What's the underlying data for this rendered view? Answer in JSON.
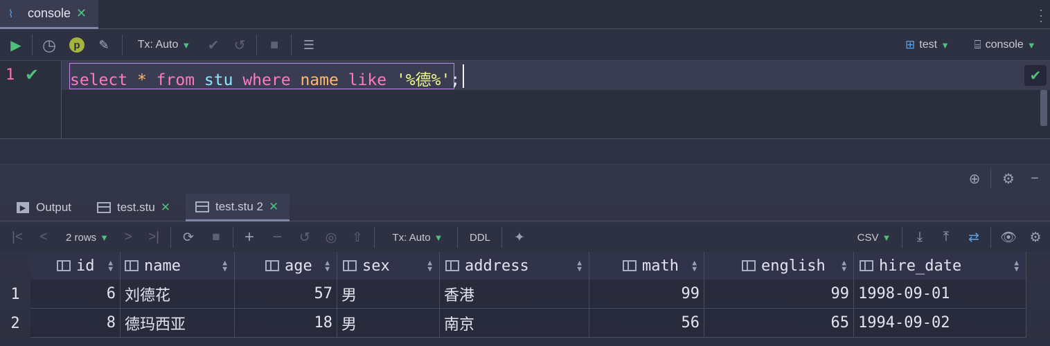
{
  "editor_tab": {
    "label": "console",
    "close": "✕"
  },
  "toolbar": {
    "run": "▶",
    "history": "◷",
    "profile": "p",
    "settings": "🔧",
    "tx_mode": "Tx: Auto",
    "commit": "✔",
    "rollback": "↺",
    "stop": "■",
    "datasource_label": "test",
    "session_label": "console"
  },
  "editor": {
    "line_number": "1",
    "line_status": "✔",
    "code": {
      "select": "select",
      "star": "*",
      "from": "from",
      "table": "stu",
      "where": "where",
      "column": "name",
      "like": "like",
      "literal": "'%德%'",
      "semicolon": ";"
    },
    "ok_badge": "✔"
  },
  "results": {
    "tabs": [
      {
        "label": "Output"
      },
      {
        "label": "test.stu",
        "close": "✕"
      },
      {
        "label": "test.stu 2",
        "close": "✕"
      }
    ],
    "toolbar": {
      "rows_label": "2 rows",
      "tx_mode": "Tx: Auto",
      "ddl": "DDL",
      "export_format": "CSV"
    },
    "columns": [
      "id",
      "name",
      "age",
      "sex",
      "address",
      "math",
      "english",
      "hire_date"
    ],
    "rows": [
      {
        "num": "1",
        "id": "6",
        "name": "刘德花",
        "age": "57",
        "sex": "男",
        "address": "香港",
        "math": "99",
        "english": "99",
        "hire_date": "1998-09-01"
      },
      {
        "num": "2",
        "id": "8",
        "name": "德玛西亚",
        "age": "18",
        "sex": "男",
        "address": "南京",
        "math": "56",
        "english": "65",
        "hire_date": "1994-09-02"
      }
    ]
  }
}
